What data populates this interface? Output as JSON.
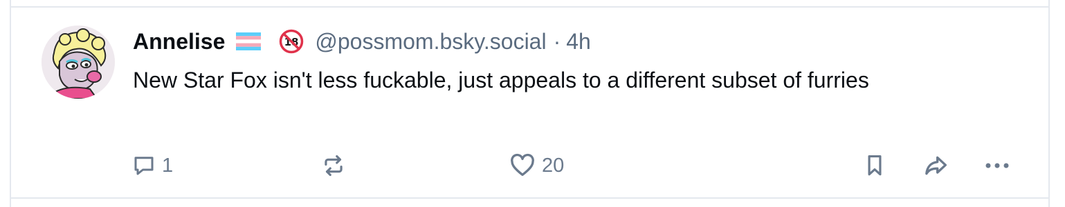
{
  "post": {
    "author": {
      "display_name": "Annelise",
      "handle": "@possmom.bsky.social",
      "avatar_icon": "avatar-cartoon-opossum",
      "badges": [
        "trans-flag-icon",
        "no-under-18-icon"
      ]
    },
    "separator": "·",
    "time": "4h",
    "text": "New Star Fox isn't less fuckable, just appeals to a different subset of furries",
    "actions": {
      "reply_count": "1",
      "repost_count": "",
      "like_count": "20"
    }
  },
  "colors": {
    "text_primary": "#0b0f14",
    "text_muted": "#5a6b7f",
    "icon": "#6b7a8d",
    "border": "#e4e8ee",
    "trans_blue": "#5bcefa",
    "trans_pink": "#f5a9b8",
    "nsfw_red": "#e0324b"
  }
}
